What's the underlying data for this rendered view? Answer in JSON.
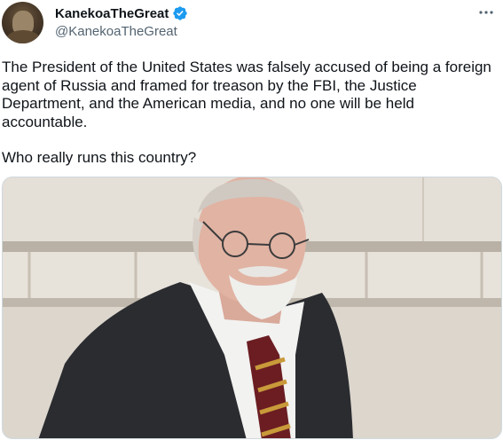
{
  "author": {
    "display_name": "KanekoaTheGreat",
    "handle": "@KanekoaTheGreat",
    "verified": true,
    "verified_color": "#1d9bf0"
  },
  "tweet": {
    "text": "The President of the United States was falsely accused of being a foreign agent of Russia and framed for treason by the FBI, the Justice Department, and the American media, and no one will be held accountable.",
    "question": "Who really runs this country?"
  },
  "icons": {
    "more": "more-horizontal-icon",
    "verified": "verified-badge-icon"
  },
  "colors": {
    "text": "#0f1419",
    "secondary_text": "#536471",
    "border": "#cfd9de"
  }
}
